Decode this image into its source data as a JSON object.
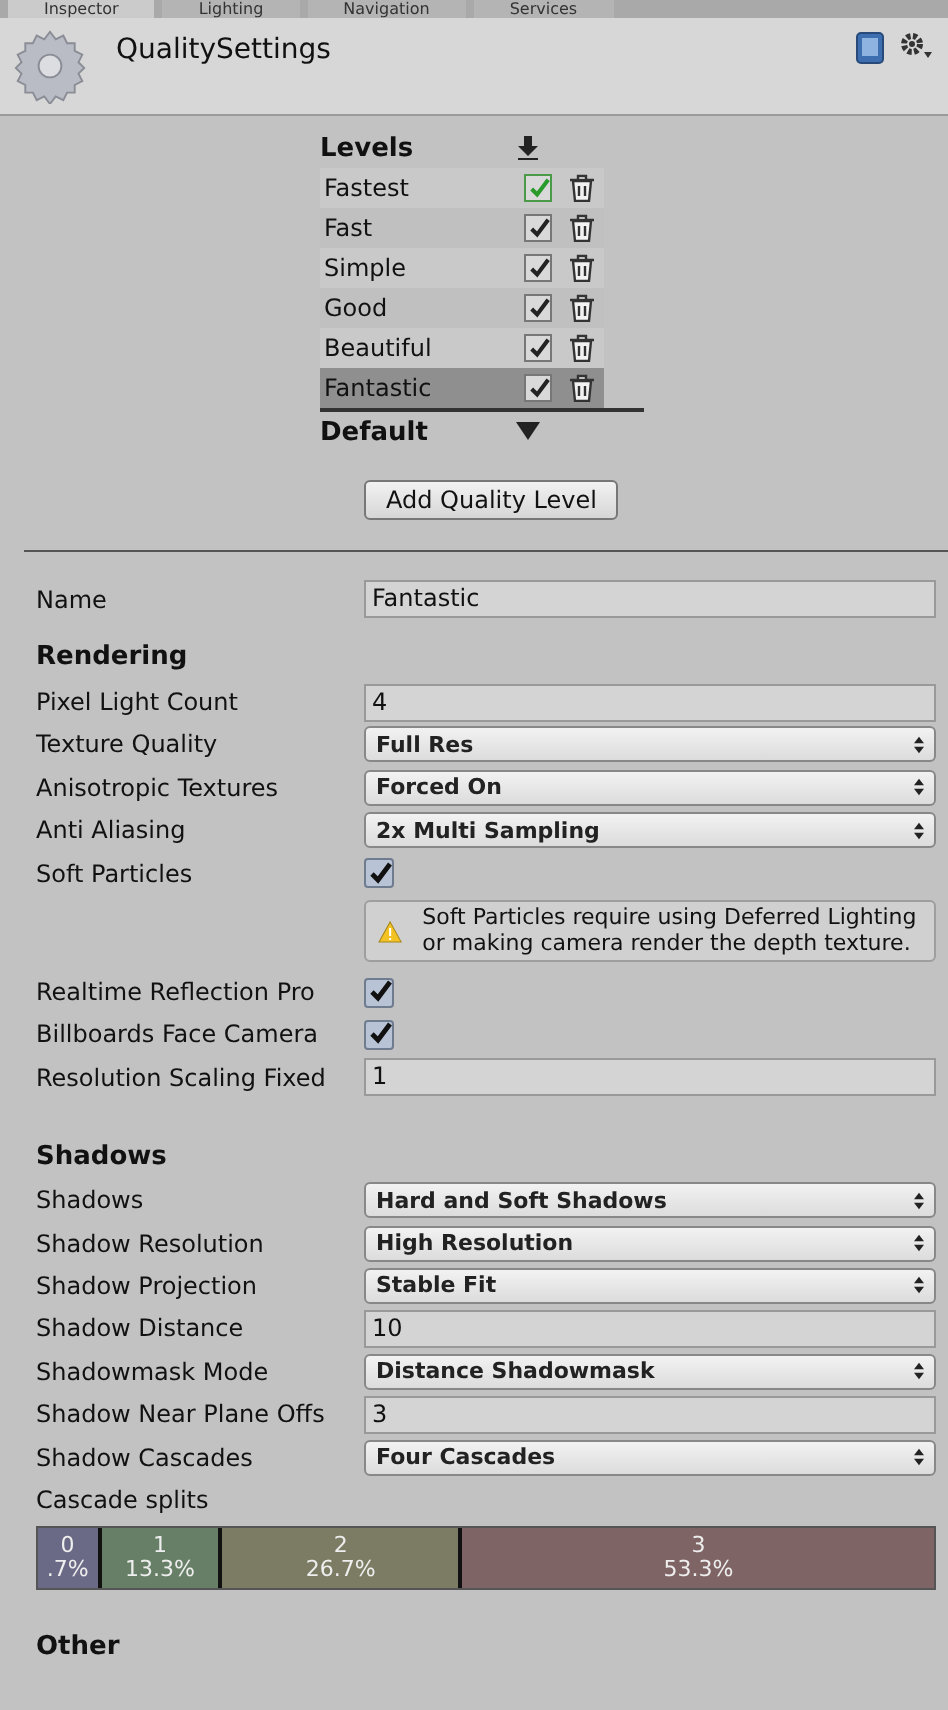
{
  "tabs": [
    {
      "label": "Inspector",
      "selected": true
    },
    {
      "label": "Lighting",
      "selected": false
    },
    {
      "label": "Navigation",
      "selected": false
    },
    {
      "label": "Services",
      "selected": false
    }
  ],
  "header": {
    "title": "QualitySettings"
  },
  "levels": {
    "title": "Levels",
    "items": [
      {
        "name": "Fastest",
        "checked": true,
        "active": true,
        "selected": false
      },
      {
        "name": "Fast",
        "checked": true,
        "active": false,
        "selected": false
      },
      {
        "name": "Simple",
        "checked": true,
        "active": false,
        "selected": false
      },
      {
        "name": "Good",
        "checked": true,
        "active": false,
        "selected": false
      },
      {
        "name": "Beautiful",
        "checked": true,
        "active": false,
        "selected": false
      },
      {
        "name": "Fantastic",
        "checked": true,
        "active": false,
        "selected": true
      }
    ],
    "default_label": "Default",
    "add_button": "Add Quality Level"
  },
  "name_field": {
    "label": "Name",
    "value": "Fantastic"
  },
  "sections": [
    {
      "title": "Rendering",
      "rows": [
        {
          "kind": "text",
          "label": "Pixel Light Count",
          "value": "4"
        },
        {
          "kind": "dropdown",
          "label": "Texture Quality",
          "value": "Full Res"
        },
        {
          "kind": "dropdown",
          "label": "Anisotropic Textures",
          "value": "Forced On"
        },
        {
          "kind": "dropdown",
          "label": "Anti Aliasing",
          "value": "2x Multi Sampling"
        },
        {
          "kind": "checkbox",
          "label": "Soft Particles",
          "checked": true
        },
        {
          "kind": "warning",
          "text": "Soft Particles require using Deferred Lighting or making camera render the depth texture."
        },
        {
          "kind": "checkbox",
          "label": "Realtime Reflection Pro",
          "checked": true
        },
        {
          "kind": "checkbox",
          "label": "Billboards Face Camera",
          "checked": true
        },
        {
          "kind": "text",
          "label": "Resolution Scaling Fixed",
          "value": "1"
        }
      ]
    },
    {
      "title": "Shadows",
      "rows": [
        {
          "kind": "dropdown",
          "label": "Shadows",
          "value": "Hard and Soft Shadows"
        },
        {
          "kind": "dropdown",
          "label": "Shadow Resolution",
          "value": "High Resolution"
        },
        {
          "kind": "dropdown",
          "label": "Shadow Projection",
          "value": "Stable Fit"
        },
        {
          "kind": "text",
          "label": "Shadow Distance",
          "value": "10"
        },
        {
          "kind": "dropdown",
          "label": "Shadowmask Mode",
          "value": "Distance Shadowmask"
        },
        {
          "kind": "text",
          "label": "Shadow Near Plane Offs",
          "value": "3"
        },
        {
          "kind": "dropdown",
          "label": "Shadow Cascades",
          "value": "Four Cascades"
        }
      ]
    }
  ],
  "cascades": {
    "label": "Cascade splits",
    "segments": [
      {
        "index": "0",
        "percent": ".7%",
        "level": 0.067,
        "color": "#6a6a86"
      },
      {
        "index": "1",
        "percent": "13.3%",
        "level": 0.133,
        "color": "#667f66"
      },
      {
        "index": "2",
        "percent": "26.7%",
        "level": 0.267,
        "color": "#7c7b63"
      },
      {
        "index": "3",
        "percent": "53.3%",
        "level": 0.533,
        "color": "#7e6464"
      }
    ]
  },
  "next_section": "Other"
}
